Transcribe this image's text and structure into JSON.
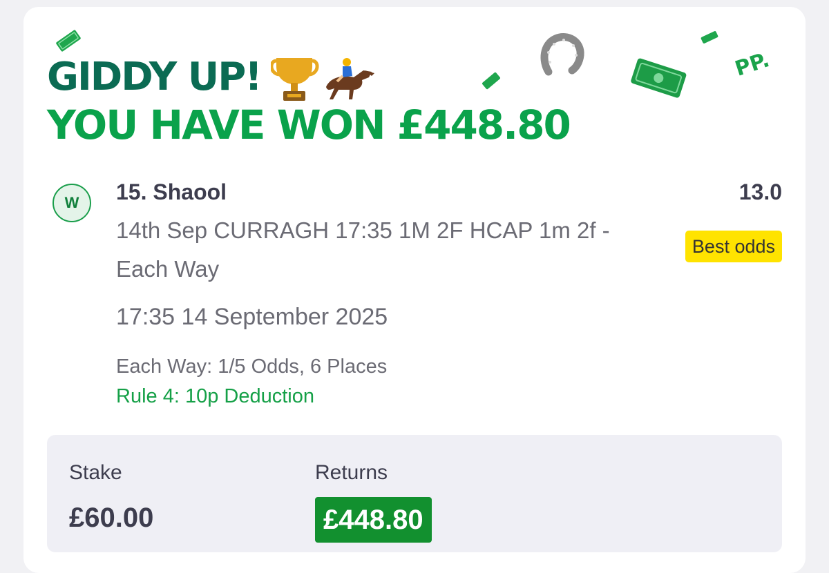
{
  "banner": {
    "headline": "GIDDY UP!",
    "icons": [
      "trophy-icon",
      "horse-racing-icon",
      "horseshoe-icon",
      "banknote-icon"
    ],
    "win_message": "YOU HAVE WON £448.80",
    "brand_mark": "PP."
  },
  "selection": {
    "result": "W",
    "name": "15. Shaool",
    "odds": "13.0",
    "best_odds_badge": "Best odds",
    "market": "14th Sep CURRAGH 17:35 1M 2F HCAP 1m 2f - Each Way",
    "race_time": "17:35 14 September 2025",
    "each_way_terms": "Each Way: 1/5 Odds, 6 Places",
    "rule4": "Rule 4: 10p Deduction"
  },
  "summary": {
    "stake_label": "Stake",
    "stake_value": "£60.00",
    "returns_label": "Returns",
    "returns_value": "£448.80"
  },
  "colors": {
    "page_bg": "#f1f1f4",
    "headline_green": "#0b6b53",
    "win_green": "#0aa24b",
    "best_odds_yellow": "#ffe300",
    "returns_green": "#12902f",
    "rule4_green": "#15a047"
  }
}
